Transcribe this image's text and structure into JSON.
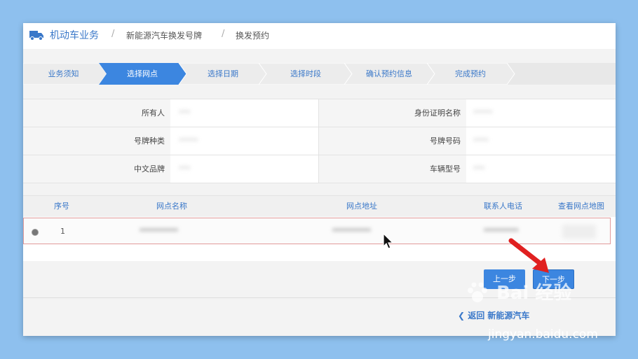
{
  "breadcrumb": {
    "main": "机动车业务",
    "sep": "/",
    "level2": "新能源汽车换发号牌",
    "level3": "换发预约"
  },
  "steps": [
    {
      "label": "业务须知",
      "active": false
    },
    {
      "label": "选择网点",
      "active": true
    },
    {
      "label": "选择日期",
      "active": false
    },
    {
      "label": "选择时段",
      "active": false
    },
    {
      "label": "确认预约信息",
      "active": false
    },
    {
      "label": "完成预约",
      "active": false
    }
  ],
  "vehicle_info": {
    "owner_label": "所有人",
    "owner_value": "***",
    "id_label": "身份证明名称",
    "id_value": "*****",
    "plate_type_label": "号牌种类",
    "plate_type_value": "*****",
    "plate_number_label": "号牌号码",
    "plate_number_value": "****",
    "brand_label": "中文品牌",
    "brand_value": "***",
    "model_label": "车辆型号",
    "model_value": "***"
  },
  "outlet_table": {
    "columns": [
      "序号",
      "网点名称",
      "网点地址",
      "联系人电话",
      "查看网点地图"
    ],
    "rows": [
      {
        "index": "1",
        "name": "**********",
        "address": "**********",
        "phone": "*********",
        "map": "****"
      }
    ]
  },
  "buttons": {
    "prev": "上一步",
    "next": "下一步"
  },
  "back_link": "返回 新能源汽车",
  "watermark": {
    "text": "Bai 经验",
    "url": "jingyan.baidu.com"
  },
  "colors": {
    "accent": "#3a78c9",
    "active_step": "#3c86e0",
    "background": "#8ec0ee",
    "arrow": "#e02020"
  }
}
